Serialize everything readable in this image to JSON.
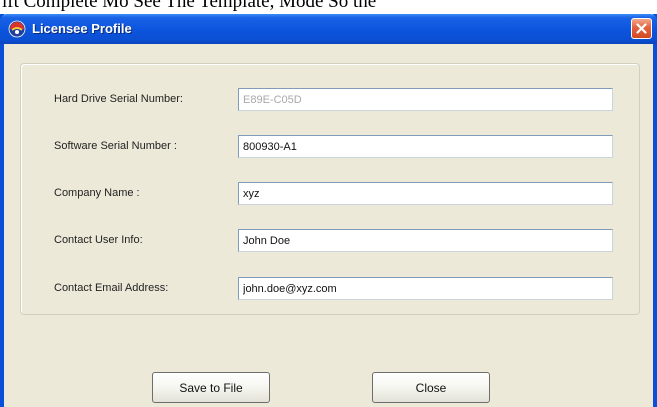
{
  "background_text": "ift Complete  Mo  See  The  Template,  Mode  So  the",
  "window": {
    "title": "Licensee Profile"
  },
  "form": {
    "fields": [
      {
        "label": "Hard Drive Serial Number:",
        "value": "E89E-C05D",
        "disabled": true
      },
      {
        "label": "Software Serial Number :",
        "value": "800930-A1",
        "disabled": false
      },
      {
        "label": "Company Name :",
        "value": "xyz",
        "disabled": false
      },
      {
        "label": "Contact User Info:",
        "value": "John Doe",
        "disabled": false
      },
      {
        "label": "Contact Email Address:",
        "value": "john.doe@xyz.com",
        "disabled": false
      }
    ]
  },
  "buttons": {
    "save_label": "Save to File",
    "close_label": "Close"
  },
  "colors": {
    "titlebar": "#0c55de",
    "dialog_bg": "#ece9d8",
    "close_button": "#e2623d",
    "input_border": "#7f9db9"
  },
  "icons": {
    "app": "app-logo-icon",
    "close": "close-x-icon"
  }
}
